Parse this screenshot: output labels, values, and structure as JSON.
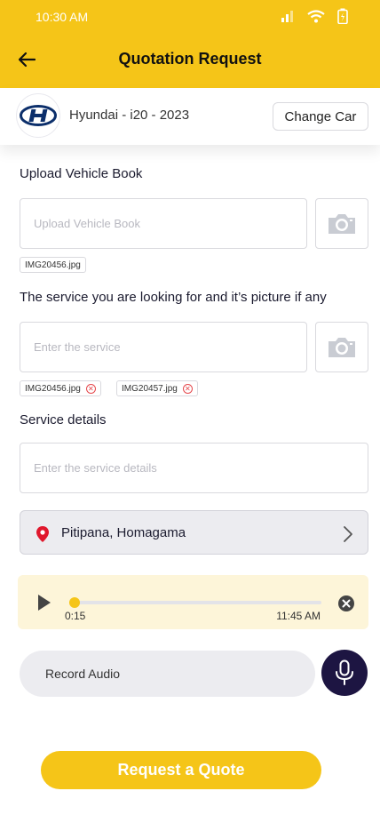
{
  "status_bar": {
    "time": "10:30 AM"
  },
  "header": {
    "title": "Quotation Request"
  },
  "car": {
    "name": "Hyundai - i20 - 2023",
    "change_label": "Change Car"
  },
  "upload_book": {
    "label": "Upload Vehicle Book",
    "placeholder": "Upload Vehicle Book",
    "files": [
      "IMG20456.jpg"
    ]
  },
  "service": {
    "label": "The service you are looking for and it’s picture if any",
    "placeholder": "Enter the service",
    "files": [
      "IMG20456.jpg",
      "IMG20457.jpg"
    ]
  },
  "service_details": {
    "label": "Service details",
    "placeholder": "Enter the service details"
  },
  "location": {
    "text": "Pitipana, Homagama"
  },
  "audio": {
    "current": "0:15",
    "time": "11:45 AM",
    "progress": 0.02
  },
  "record": {
    "label": "Record Audio"
  },
  "cta": {
    "label": "Request a Quote"
  },
  "colors": {
    "accent": "#f5c518",
    "mic_bg": "#1d1542",
    "remove": "#e5484d",
    "pin": "#e0182d"
  },
  "icons": [
    "back-arrow-icon",
    "signal-icon",
    "wifi-icon",
    "battery-icon",
    "hyundai-logo",
    "camera-icon",
    "remove-icon",
    "location-pin-icon",
    "chevron-right-icon",
    "play-icon",
    "close-circle-icon",
    "microphone-icon"
  ]
}
